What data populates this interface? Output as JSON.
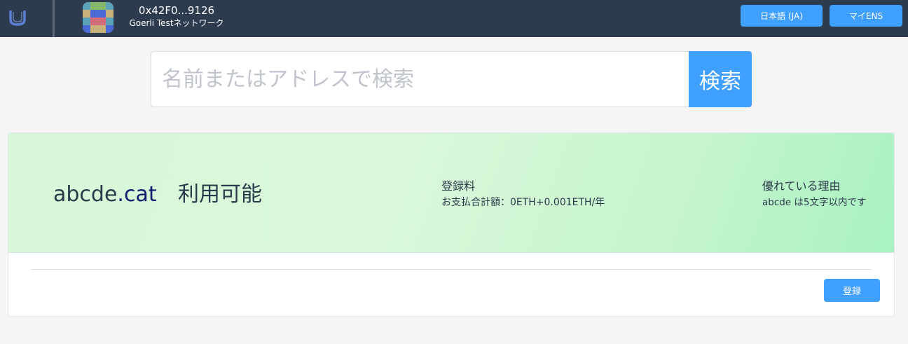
{
  "header": {
    "account_address": "0x42F0...9126",
    "network": "Goerli Testネットワーク",
    "language_button": "日本語 (JA)",
    "my_ens_button": "マイENS"
  },
  "search": {
    "placeholder": "名前またはアドレスで検索",
    "value": "",
    "button_label": "検索"
  },
  "result": {
    "name": "abcde",
    "tld": ".cat",
    "status": "利用可能",
    "fee_title": "登録料",
    "fee_detail": "お支払合計額：0ETH+0.001ETH/年",
    "reason_title": "優れている理由",
    "reason_detail": "abcde は5文字以内です",
    "register_button": "登録"
  },
  "colors": {
    "topbar": "#2d3b4e",
    "accent": "#40a0ff",
    "banner_start": "#d8f7d8",
    "banner_end": "#a8f2c2"
  }
}
